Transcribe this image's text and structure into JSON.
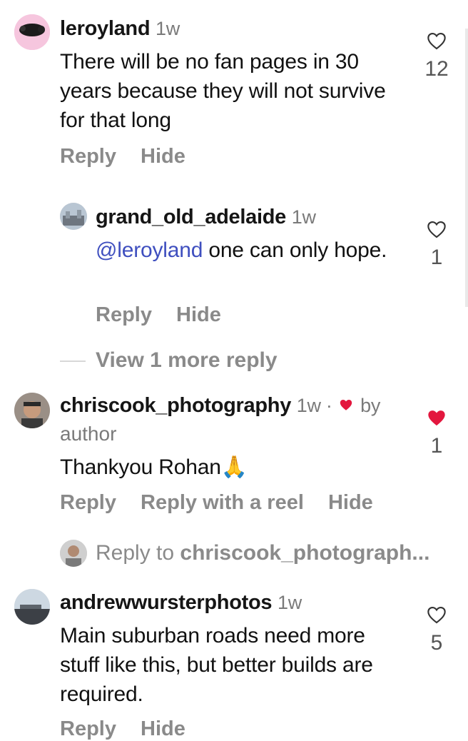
{
  "comments": [
    {
      "username": "leroyland",
      "time": "1w",
      "text": "There will be no fan pages in 30 years because they will not survive for that long",
      "like_count": "12",
      "actions": [
        "Reply",
        "Hide"
      ]
    },
    {
      "username": "grand_old_adelaide",
      "time": "1w",
      "mention": "@leroyland",
      "text": " one can only hope.",
      "like_count": "1",
      "actions": [
        "Reply",
        "Hide"
      ]
    },
    {
      "username": "chriscook_photography",
      "time": "1w ·",
      "liked_by": "by",
      "author": "author",
      "text": "Thankyou Rohan🙏",
      "like_count": "1",
      "actions": [
        "Reply",
        "Reply with a reel",
        "Hide"
      ]
    },
    {
      "username": "andrewwursterphotos",
      "time": "1w",
      "text": "Main suburban roads need more stuff like this, but better builds are required.",
      "like_count": "5",
      "actions": [
        "Reply",
        "Hide"
      ]
    }
  ],
  "view_more": "View 1 more reply",
  "reply_to": {
    "prefix": "Reply to ",
    "user": "chriscook_photograph..."
  },
  "colors": {
    "heart_liked": "#e3173e",
    "mention": "#3f4fbf",
    "muted": "#8a8a8a"
  }
}
